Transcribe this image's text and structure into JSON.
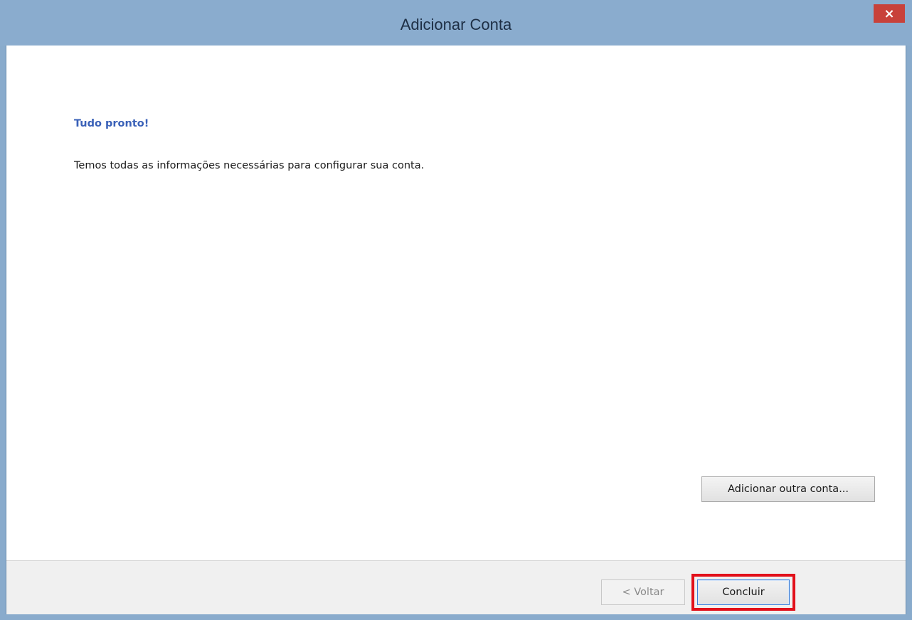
{
  "window": {
    "title": "Adicionar Conta",
    "close_glyph": "×"
  },
  "content": {
    "heading": "Tudo pronto!",
    "message": "Temos todas as informações necessárias para configurar sua conta.",
    "add_other_account_label": "Adicionar outra conta..."
  },
  "footer": {
    "back_label": "< Voltar",
    "finish_label": "Concluir"
  },
  "colors": {
    "titlebar": "#8aacce",
    "heading": "#3a61b8",
    "highlight": "#e2101a",
    "close": "#c8413a"
  }
}
